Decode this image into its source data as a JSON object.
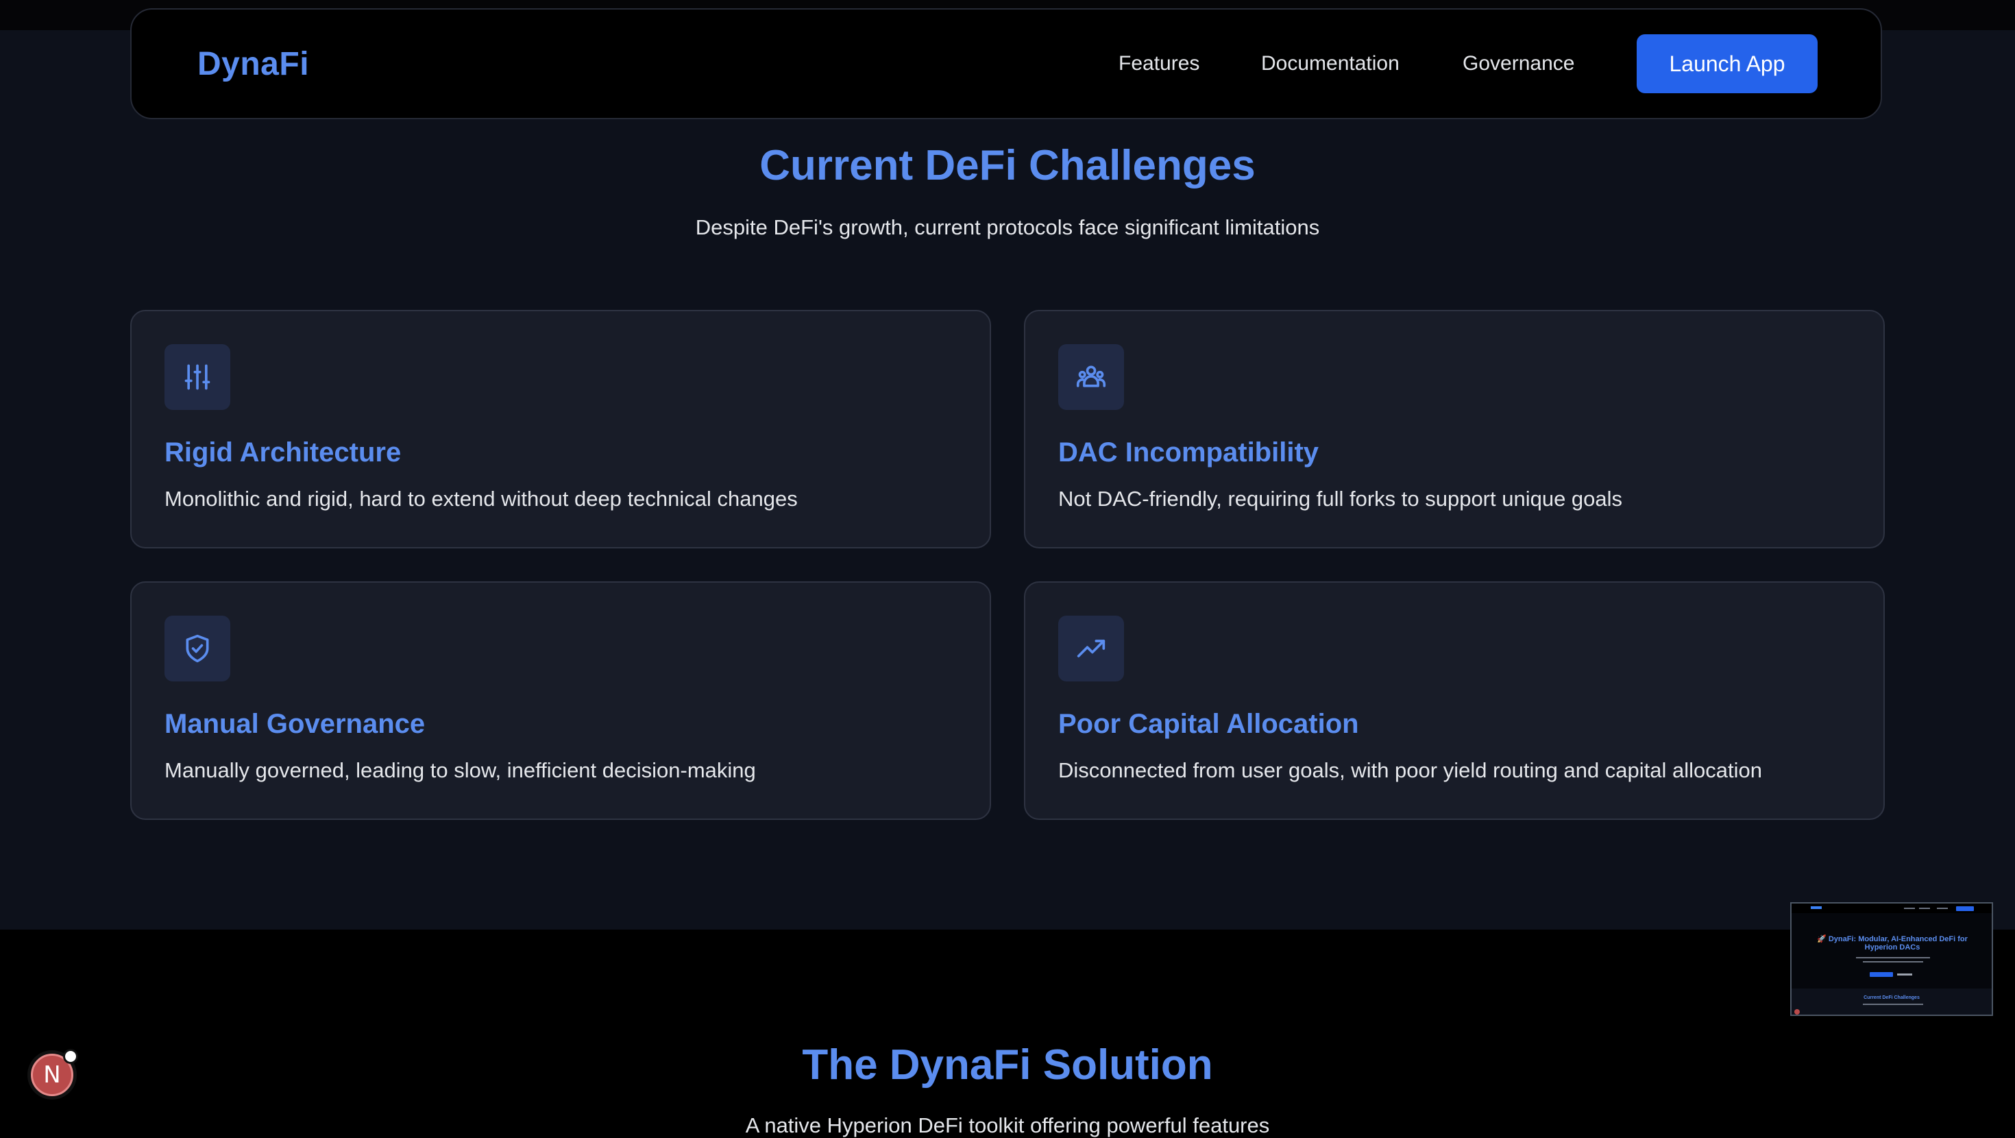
{
  "nav": {
    "brand": "DynaFi",
    "links": [
      "Features",
      "Documentation",
      "Governance"
    ],
    "cta": "Launch App"
  },
  "challenges": {
    "title": "Current DeFi Challenges",
    "subtitle": "Despite DeFi's growth, current protocols face significant limitations",
    "cards": [
      {
        "icon": "sliders-icon",
        "title": "Rigid Architecture",
        "description": "Monolithic and rigid, hard to extend without deep technical changes"
      },
      {
        "icon": "users-icon",
        "title": "DAC Incompatibility",
        "description": "Not DAC-friendly, requiring full forks to support unique goals"
      },
      {
        "icon": "shield-check-icon",
        "title": "Manual Governance",
        "description": "Manually governed, leading to slow, inefficient decision-making"
      },
      {
        "icon": "trending-up-icon",
        "title": "Poor Capital Allocation",
        "description": "Disconnected from user goals, with poor yield routing and capital allocation"
      }
    ]
  },
  "solution": {
    "title": "The DynaFi Solution",
    "subtitle": "A native Hyperion DeFi toolkit offering powerful features"
  },
  "minimap": {
    "hero_title": "🚀 DynaFi: Modular, AI-Enhanced DeFi for Hyperion DACs",
    "section_title": "Current DeFi Challenges"
  },
  "dev_badge": {
    "letter": "N"
  },
  "colors": {
    "accent": "#5b8def",
    "button": "#2563eb",
    "section_bg": "#0d111b",
    "card_bg": "#181c28",
    "card_border": "#2e3342"
  }
}
